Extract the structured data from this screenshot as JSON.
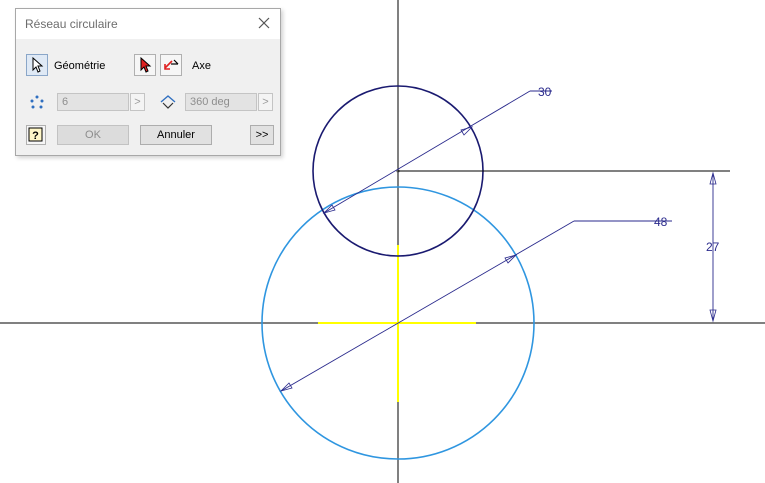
{
  "dialog": {
    "title": "Réseau circulaire",
    "geometry_label": "Géométrie",
    "axis_label": "Axe",
    "count_value": "6",
    "angle_value": "360 deg",
    "arrow_glyph": ">",
    "ok_label": "OK",
    "cancel_label": "Annuler",
    "more_label": ">>"
  },
  "sketch": {
    "dim_small_diameter": "30",
    "dim_large_diameter": "48",
    "dim_vertical_distance": "27",
    "colors": {
      "small_circle": "#1a1a70",
      "large_circle": "#2f96e0",
      "dimension": "#2a2a8c",
      "axis": "#000000",
      "center_mark": "#ffff00"
    }
  }
}
